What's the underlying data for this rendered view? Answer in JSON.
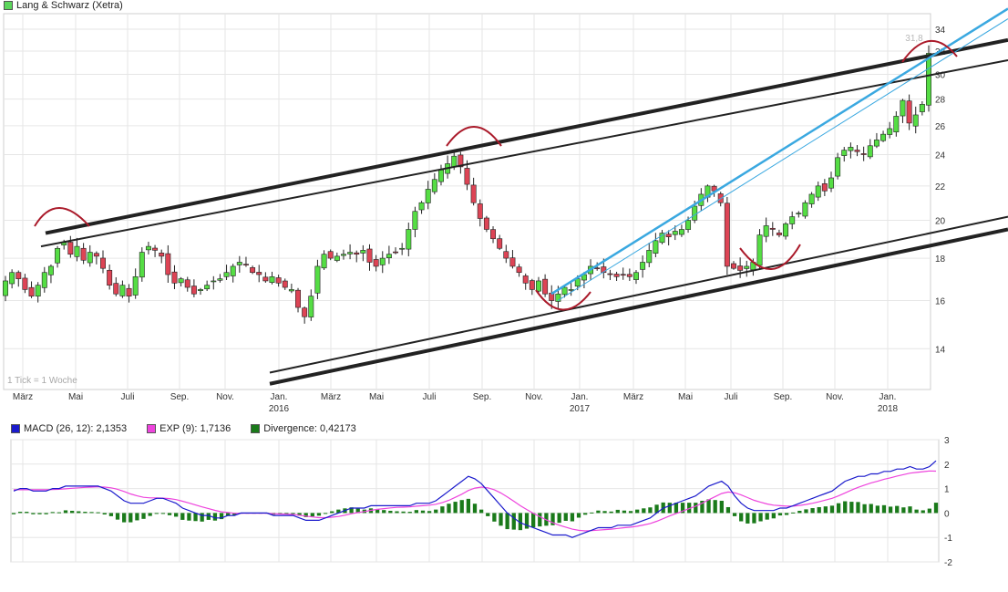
{
  "chart_data": [
    {
      "type": "candlestick",
      "legend": [
        {
          "label": "Lang & Schwarz (Xetra)",
          "color": "#5cd65c"
        }
      ],
      "x_ticks": [
        "März",
        "Mai",
        "Juli",
        "Sep.",
        "Nov.",
        "Jan.",
        "März",
        "Mai",
        "Juli",
        "Sep.",
        "Nov.",
        "Jan.",
        "März",
        "Mai",
        "Juli",
        "Sep.",
        "Nov.",
        "Jan."
      ],
      "x_year_labels": [
        "2016",
        "2017",
        "2018"
      ],
      "y_ticks": [
        "14",
        "16",
        "18",
        "20",
        "22",
        "24",
        "26",
        "28",
        "30",
        "32",
        "34"
      ],
      "y_scale": "log",
      "ylim": [
        12.5,
        35.5
      ],
      "note": "1 Tick = 1 Woche",
      "last_price_label": "31,8",
      "up_color": "#55dd44",
      "down_color": "#dd4455",
      "trend_line_color": "#222222",
      "channel_line_color": "#3aa8e0",
      "annotation_color": "#aa1a2a",
      "weekly_closes": [
        16.9,
        17.3,
        17.0,
        16.5,
        16.2,
        16.7,
        17.3,
        17.6,
        18.5,
        18.8,
        18.2,
        18.6,
        17.9,
        18.3,
        18.1,
        17.5,
        16.7,
        16.3,
        16.7,
        16.2,
        17.1,
        18.3,
        18.6,
        18.4,
        18.1,
        17.2,
        16.8,
        17.0,
        16.6,
        16.3,
        16.5,
        16.7,
        16.9,
        17.0,
        17.3,
        17.6,
        17.8,
        17.7,
        17.3,
        17.2,
        16.9,
        17.1,
        16.8,
        16.6,
        16.5,
        15.7,
        15.3,
        16.2,
        17.6,
        18.2,
        18.0,
        18.1,
        18.2,
        18.3,
        18.2,
        18.4,
        17.8,
        17.6,
        18.0,
        18.2,
        18.3,
        18.5,
        19.5,
        20.5,
        21.0,
        21.8,
        22.4,
        23.0,
        23.4,
        23.9,
        23.2,
        22.1,
        21.0,
        20.1,
        19.5,
        19.0,
        18.5,
        18.0,
        17.6,
        17.3,
        16.8,
        16.5,
        16.9,
        16.3,
        16.0,
        16.3,
        16.6,
        16.5,
        17.0,
        17.2,
        17.6,
        17.5,
        17.3,
        17.2,
        17.1,
        17.2,
        17.1,
        17.3,
        17.8,
        18.4,
        18.9,
        19.3,
        19.1,
        19.4,
        19.5,
        20.0,
        20.8,
        21.5,
        22.0,
        21.7,
        21.0,
        17.6,
        17.5,
        17.4,
        17.6,
        17.8,
        19.2,
        19.7,
        19.5,
        19.2,
        19.8,
        20.2,
        20.4,
        21.0,
        21.5,
        22.0,
        21.7,
        22.5,
        23.8,
        24.3,
        24.5,
        24.2,
        24.0,
        24.6,
        25.0,
        25.4,
        25.8,
        26.7,
        27.9,
        26.2,
        26.8,
        27.6,
        31.8
      ]
    },
    {
      "type": "line",
      "legend": [
        {
          "label": "MACD (26, 12): 2,1353",
          "color": "#1a1acc"
        },
        {
          "label": "EXP (9): 1,7136",
          "color": "#ee44dd"
        },
        {
          "label": "Divergence: 0,42173",
          "color": "#1a7a1a"
        }
      ],
      "y_ticks": [
        "-2",
        "-1",
        "0",
        "1",
        "2",
        "3"
      ],
      "ylim": [
        -2,
        3
      ],
      "series": [
        {
          "key": "macd",
          "color": "#1a1acc",
          "values": [
            0.9,
            1.0,
            1.0,
            0.9,
            0.9,
            0.9,
            1.0,
            1.0,
            1.1,
            1.1,
            1.1,
            1.1,
            1.1,
            1.1,
            1.0,
            0.9,
            0.7,
            0.5,
            0.4,
            0.4,
            0.4,
            0.5,
            0.6,
            0.6,
            0.5,
            0.4,
            0.2,
            0.1,
            0.0,
            -0.1,
            -0.1,
            -0.2,
            -0.2,
            -0.1,
            -0.1,
            0.0,
            0.0,
            0.0,
            0.0,
            0.0,
            -0.1,
            -0.1,
            -0.1,
            -0.1,
            -0.2,
            -0.3,
            -0.3,
            -0.3,
            -0.2,
            -0.1,
            0.0,
            0.1,
            0.2,
            0.2,
            0.2,
            0.3,
            0.3,
            0.3,
            0.3,
            0.3,
            0.3,
            0.3,
            0.4,
            0.4,
            0.4,
            0.5,
            0.7,
            0.9,
            1.1,
            1.3,
            1.5,
            1.4,
            1.2,
            0.9,
            0.6,
            0.3,
            0.0,
            -0.2,
            -0.4,
            -0.5,
            -0.6,
            -0.7,
            -0.8,
            -0.9,
            -0.9,
            -0.9,
            -1.0,
            -0.9,
            -0.8,
            -0.7,
            -0.6,
            -0.6,
            -0.6,
            -0.5,
            -0.5,
            -0.5,
            -0.4,
            -0.3,
            -0.2,
            0.0,
            0.2,
            0.3,
            0.4,
            0.5,
            0.6,
            0.7,
            0.9,
            1.1,
            1.2,
            1.3,
            1.1,
            0.7,
            0.4,
            0.2,
            0.1,
            0.1,
            0.1,
            0.1,
            0.2,
            0.2,
            0.3,
            0.4,
            0.5,
            0.6,
            0.7,
            0.8,
            0.9,
            1.1,
            1.3,
            1.4,
            1.5,
            1.5,
            1.6,
            1.6,
            1.7,
            1.7,
            1.8,
            1.8,
            1.9,
            1.8,
            1.8,
            1.9,
            2.1353
          ]
        },
        {
          "key": "exp",
          "color": "#ee44dd",
          "values": [
            0.95,
            0.95,
            0.95,
            0.95,
            0.95,
            0.95,
            0.96,
            0.97,
            0.99,
            1.01,
            1.03,
            1.05,
            1.06,
            1.07,
            1.06,
            1.03,
            0.97,
            0.88,
            0.78,
            0.7,
            0.64,
            0.62,
            0.62,
            0.61,
            0.59,
            0.55,
            0.48,
            0.41,
            0.33,
            0.25,
            0.18,
            0.11,
            0.05,
            0.02,
            -0.01,
            -0.01,
            -0.01,
            -0.01,
            -0.01,
            -0.01,
            -0.03,
            -0.04,
            -0.05,
            -0.06,
            -0.09,
            -0.13,
            -0.16,
            -0.19,
            -0.19,
            -0.17,
            -0.14,
            -0.09,
            -0.03,
            0.02,
            0.06,
            0.11,
            0.15,
            0.18,
            0.21,
            0.23,
            0.24,
            0.25,
            0.28,
            0.3,
            0.32,
            0.36,
            0.43,
            0.52,
            0.64,
            0.77,
            0.92,
            1.02,
            1.06,
            1.03,
            0.95,
            0.82,
            0.66,
            0.48,
            0.3,
            0.14,
            -0.01,
            -0.15,
            -0.28,
            -0.4,
            -0.5,
            -0.58,
            -0.66,
            -0.71,
            -0.73,
            -0.72,
            -0.7,
            -0.68,
            -0.66,
            -0.63,
            -0.6,
            -0.58,
            -0.54,
            -0.49,
            -0.43,
            -0.34,
            -0.23,
            -0.12,
            -0.02,
            0.08,
            0.18,
            0.28,
            0.4,
            0.54,
            0.67,
            0.8,
            0.86,
            0.83,
            0.74,
            0.63,
            0.52,
            0.44,
            0.37,
            0.32,
            0.3,
            0.28,
            0.28,
            0.31,
            0.35,
            0.4,
            0.46,
            0.53,
            0.6,
            0.7,
            0.82,
            0.94,
            1.05,
            1.14,
            1.23,
            1.3,
            1.38,
            1.44,
            1.51,
            1.57,
            1.63,
            1.66,
            1.69,
            1.72,
            1.7136
          ]
        }
      ],
      "bars": {
        "key": "divergence",
        "color": "#1a7a1a"
      }
    }
  ]
}
